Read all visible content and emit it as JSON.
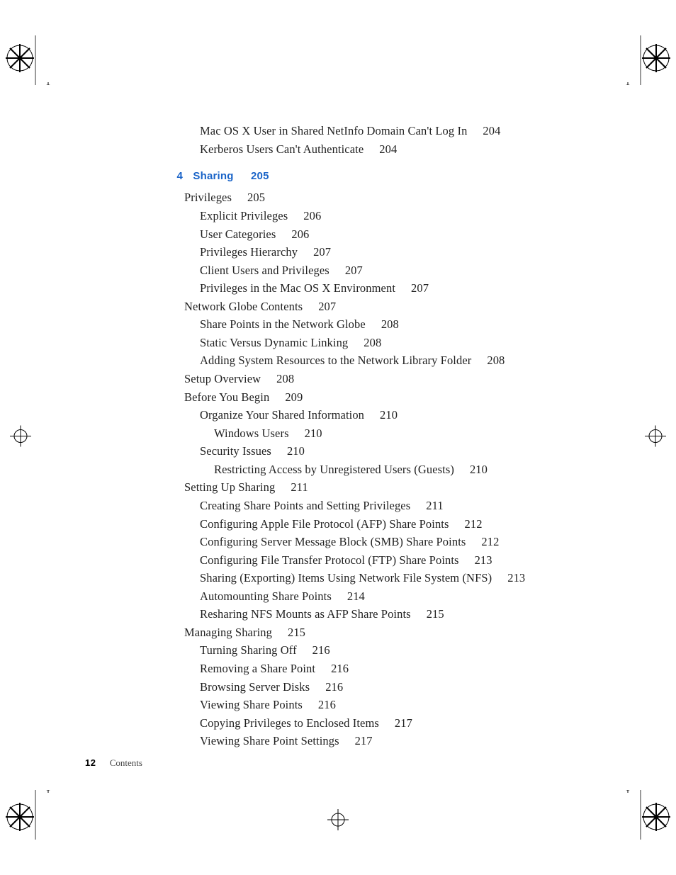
{
  "intro_lines": [
    {
      "title": "Mac OS X User in Shared NetInfo Domain Can't Log In",
      "page": "204"
    },
    {
      "title": "Kerberos Users Can't Authenticate",
      "page": "204"
    }
  ],
  "chapter": {
    "number": "4",
    "title": "Sharing",
    "page": "205"
  },
  "entries": [
    {
      "lvl": 1,
      "title": "Privileges",
      "page": "205"
    },
    {
      "lvl": 2,
      "title": "Explicit Privileges",
      "page": "206"
    },
    {
      "lvl": 2,
      "title": "User Categories",
      "page": "206"
    },
    {
      "lvl": 2,
      "title": "Privileges Hierarchy",
      "page": "207"
    },
    {
      "lvl": 2,
      "title": "Client Users and Privileges",
      "page": "207"
    },
    {
      "lvl": 2,
      "title": "Privileges in the Mac OS X Environment",
      "page": "207"
    },
    {
      "lvl": 1,
      "title": "Network Globe Contents",
      "page": "207"
    },
    {
      "lvl": 2,
      "title": "Share Points in the Network Globe",
      "page": "208"
    },
    {
      "lvl": 2,
      "title": "Static Versus Dynamic Linking",
      "page": "208"
    },
    {
      "lvl": 2,
      "title": "Adding System Resources to the Network Library Folder",
      "page": "208"
    },
    {
      "lvl": 1,
      "title": "Setup Overview",
      "page": "208"
    },
    {
      "lvl": 1,
      "title": "Before You Begin",
      "page": "209"
    },
    {
      "lvl": 2,
      "title": "Organize Your Shared Information",
      "page": "210"
    },
    {
      "lvl": 3,
      "title": "Windows Users",
      "page": "210"
    },
    {
      "lvl": 2,
      "title": "Security Issues",
      "page": "210"
    },
    {
      "lvl": 3,
      "title": "Restricting Access by Unregistered Users (Guests)",
      "page": "210"
    },
    {
      "lvl": 1,
      "title": "Setting Up Sharing",
      "page": "211"
    },
    {
      "lvl": 2,
      "title": "Creating Share Points and Setting Privileges",
      "page": "211"
    },
    {
      "lvl": 2,
      "title": "Configuring Apple File Protocol (AFP) Share Points",
      "page": "212"
    },
    {
      "lvl": 2,
      "title": "Configuring Server Message Block (SMB) Share Points",
      "page": "212"
    },
    {
      "lvl": 2,
      "title": "Configuring File Transfer Protocol (FTP) Share Points",
      "page": "213"
    },
    {
      "lvl": 2,
      "title": "Sharing (Exporting) Items Using Network File System (NFS)",
      "page": "213"
    },
    {
      "lvl": 2,
      "title": "Automounting Share Points",
      "page": "214"
    },
    {
      "lvl": 2,
      "title": "Resharing NFS Mounts as AFP Share Points",
      "page": "215"
    },
    {
      "lvl": 1,
      "title": "Managing Sharing",
      "page": "215"
    },
    {
      "lvl": 2,
      "title": "Turning Sharing Off",
      "page": "216"
    },
    {
      "lvl": 2,
      "title": "Removing a Share Point",
      "page": "216"
    },
    {
      "lvl": 2,
      "title": "Browsing Server Disks",
      "page": "216"
    },
    {
      "lvl": 2,
      "title": "Viewing Share Points",
      "page": "216"
    },
    {
      "lvl": 2,
      "title": "Copying Privileges to Enclosed Items",
      "page": "217"
    },
    {
      "lvl": 2,
      "title": "Viewing Share Point Settings",
      "page": "217"
    }
  ],
  "footer": {
    "page_number": "12",
    "label": "Contents"
  }
}
